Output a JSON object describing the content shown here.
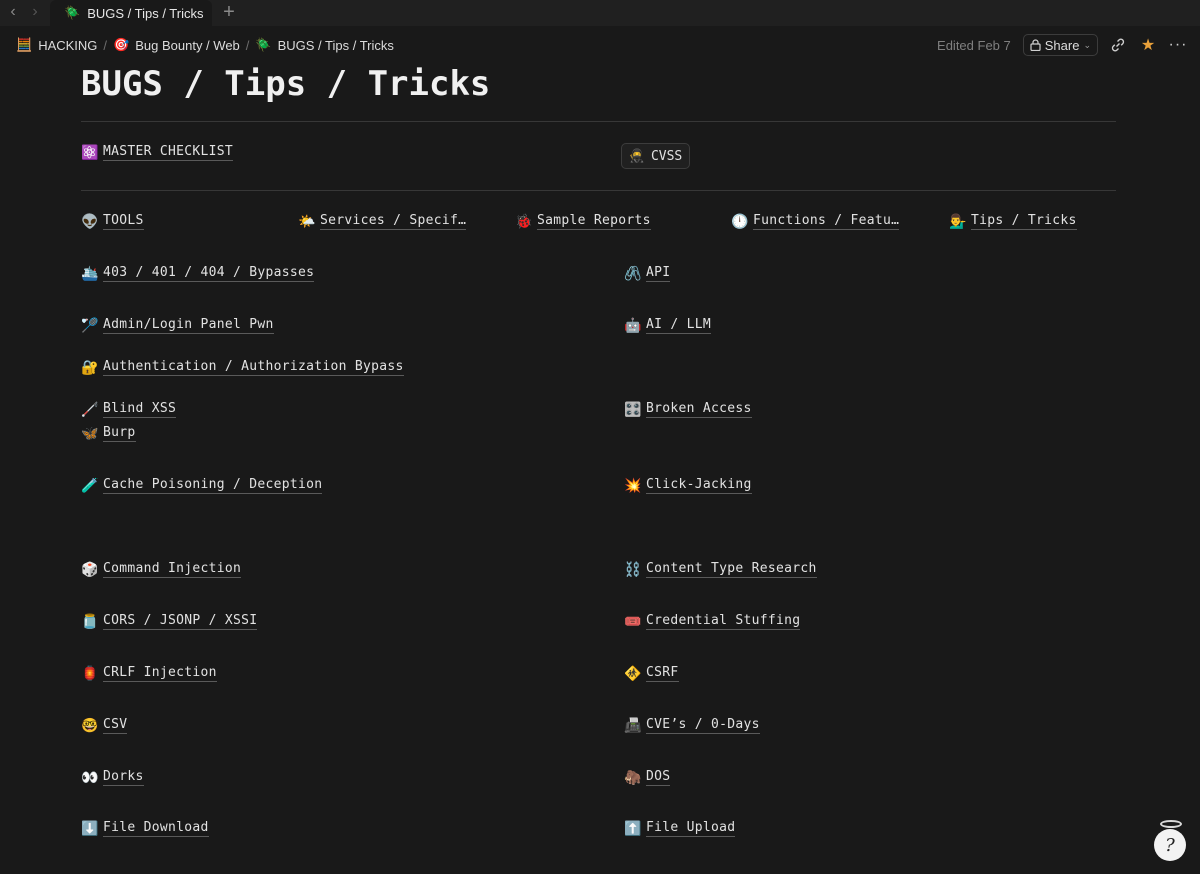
{
  "tab": {
    "icon": "🪲",
    "title": "BUGS / Tips / Tricks"
  },
  "breadcrumb": [
    {
      "icon": "🧮",
      "label": "HACKING"
    },
    {
      "icon": "🎯",
      "label": "Bug Bounty / Web"
    },
    {
      "icon": "🪲",
      "label": "BUGS / Tips / Tricks"
    }
  ],
  "topbar": {
    "edited": "Edited Feb 7",
    "share_label": "Share"
  },
  "page": {
    "title": "BUGS / Tips / Tricks"
  },
  "top_links": {
    "master": {
      "icon": "⚛️",
      "label": "MASTER CHECKLIST"
    },
    "cvss": {
      "icon": "🥷",
      "label": "CVSS"
    }
  },
  "columns": [
    {
      "icon": "👽",
      "label": "TOOLS"
    },
    {
      "icon": "🌤️",
      "label": "Services / Specif…"
    },
    {
      "icon": "🐞",
      "label": "Sample Reports"
    },
    {
      "icon": "🕛",
      "label": "Functions / Featu…"
    },
    {
      "icon": "💁‍♂️",
      "label": "Tips / Tricks"
    }
  ],
  "left_items": [
    {
      "icon": "🛳️",
      "label": "403 / 401 / 404 / Bypasses"
    },
    {
      "icon": "🏸",
      "label": "Admin/Login Panel Pwn"
    },
    {
      "icon": "🔐",
      "label": "Authentication / Authorization Bypass"
    },
    {
      "icon": "🦯",
      "label": "Blind XSS"
    },
    {
      "icon": "🦋",
      "label": "Burp"
    },
    {
      "icon": "🧪",
      "label": "Cache Poisoning / Deception"
    },
    {
      "icon": "🎲",
      "label": "Command Injection"
    },
    {
      "icon": "🫙",
      "label": "CORS / JSONP / XSSI"
    },
    {
      "icon": "🏮",
      "label": "CRLF Injection"
    },
    {
      "icon": "🤓",
      "label": "CSV"
    },
    {
      "icon": "👀",
      "label": "Dorks"
    },
    {
      "icon": "⬇️",
      "label": "File Download"
    }
  ],
  "right_items": [
    {
      "icon": "🖇️",
      "label": "API"
    },
    {
      "icon": "🤖",
      "label": "AI / LLM"
    },
    {
      "icon": "🎛️",
      "label": "Broken Access"
    },
    {
      "icon": "💥",
      "label": "Click-Jacking"
    },
    {
      "icon": "⛓️",
      "label": "Content Type Research"
    },
    {
      "icon": "🎟️",
      "label": "Credential Stuffing"
    },
    {
      "icon": "🚸",
      "label": "CSRF"
    },
    {
      "icon": "📠",
      "label": "CVE’s / 0-Days"
    },
    {
      "icon": "🦣",
      "label": "DOS"
    },
    {
      "icon": "⬆️",
      "label": "File Upload"
    }
  ],
  "help": {
    "label": "?"
  },
  "colors": {
    "background": "#191919",
    "text": "#e2e2e2",
    "star": "#e8a03a"
  }
}
